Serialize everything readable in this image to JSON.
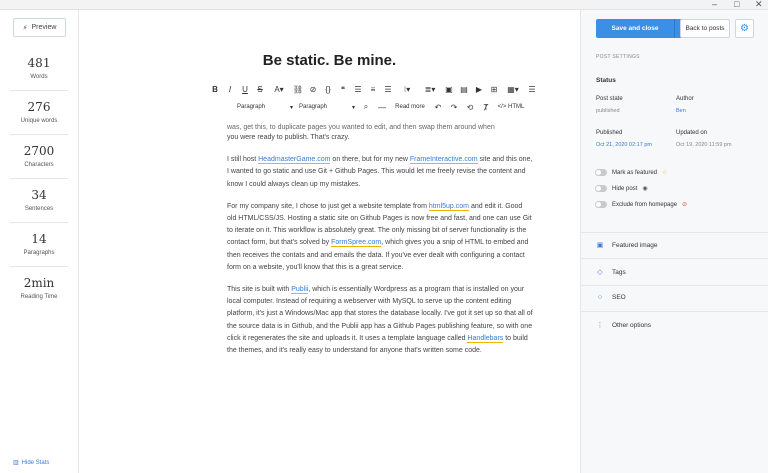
{
  "window": {
    "controls": {
      "minimize": "–",
      "maximize": "□",
      "close": "✕"
    }
  },
  "left": {
    "preview_label": "Preview",
    "stats": [
      {
        "value": "481",
        "label": "Words"
      },
      {
        "value": "276",
        "label": "Unique words"
      },
      {
        "value": "2700",
        "label": "Characters"
      },
      {
        "value": "34",
        "label": "Sentences"
      },
      {
        "value": "14",
        "label": "Paragraphs"
      },
      {
        "value": "2min",
        "label": "Reading Time"
      }
    ],
    "hide_stats_label": "Hide Stats"
  },
  "editor": {
    "title": "Be static. Be mine.",
    "toolbar": {
      "paragraph_select_1": "Paragraph",
      "paragraph_select_2": "Paragraph",
      "read_more": "Read more",
      "html": "HTML"
    },
    "clipped_line": "was, get this, to duplicate pages you wanted to edit, and then swap them around when",
    "para1_end": "you were ready to publish. That's crazy.",
    "para2": {
      "t1": "I still host ",
      "l1": "HeadmasterGame.com",
      "t2": " on there, but for my new ",
      "l2": "FrameInteractive.com",
      "t3": " site and this one, I wanted to go static and use Git + Github Pages. This would let me freely revise the content and know I could always clean up my mistakes."
    },
    "para3": {
      "t1": "For my company site, I chose to just get a website template from ",
      "l1": "html5up.com",
      "t2": " and edit it. Good old HTML/CSS/JS. Hosting a static site on Github Pages is now free and fast, and one can use Git to iterate on it. This workflow is absolutely great. The only missing bit of server functionality is the contact form, but that's solved by ",
      "l2": "FormSpree.com",
      "t3": ", which gives you a snip of HTML to embed and then receives the contats and and emails the data. If you've ever dealt with configuring a contact form on a website, you'll know that this is a great service."
    },
    "para4": {
      "t1": "This site is built with ",
      "l1": "Publii",
      "t2": ", which is essentially Wordpress as a program that is installed on your local computer. Instead of requiring a webserver with MySQL to serve up the content editing platform, it's just a Windows/Mac app that stores the database locally. I've got it set up so that all of the source data is in Github, and the Publii app has a Github Pages publishing feature, so with one click it regenerates the site and uploads it. It uses a template language called ",
      "l2": "Handlebars",
      "t3": " to build the themes, and it's really easy to understand for anyone that's written some code."
    }
  },
  "right": {
    "save_label": "Save and close",
    "back_label": "Back to posts",
    "post_settings": "POST SETTINGS",
    "status_heading": "Status",
    "post_state_label": "Post state",
    "post_state_value": "published",
    "author_label": "Author",
    "author_value": "Ben",
    "published_label": "Published",
    "published_value": "Oct 21, 2020 02:17 pm",
    "updated_label": "Updated on",
    "updated_value": "Oct 19, 2020 11:59 pm",
    "toggles": [
      {
        "label": "Mark as featured",
        "icon": "☆"
      },
      {
        "label": "Hide post",
        "icon": "◉"
      },
      {
        "label": "Exclude from homepage",
        "icon": "⊘"
      }
    ],
    "menu": [
      {
        "label": "Featured image",
        "icon": "▣"
      },
      {
        "label": "Tags",
        "icon": "◇"
      },
      {
        "label": "SEO",
        "icon": "○"
      },
      {
        "label": "Other options",
        "icon": "⋮"
      }
    ]
  }
}
